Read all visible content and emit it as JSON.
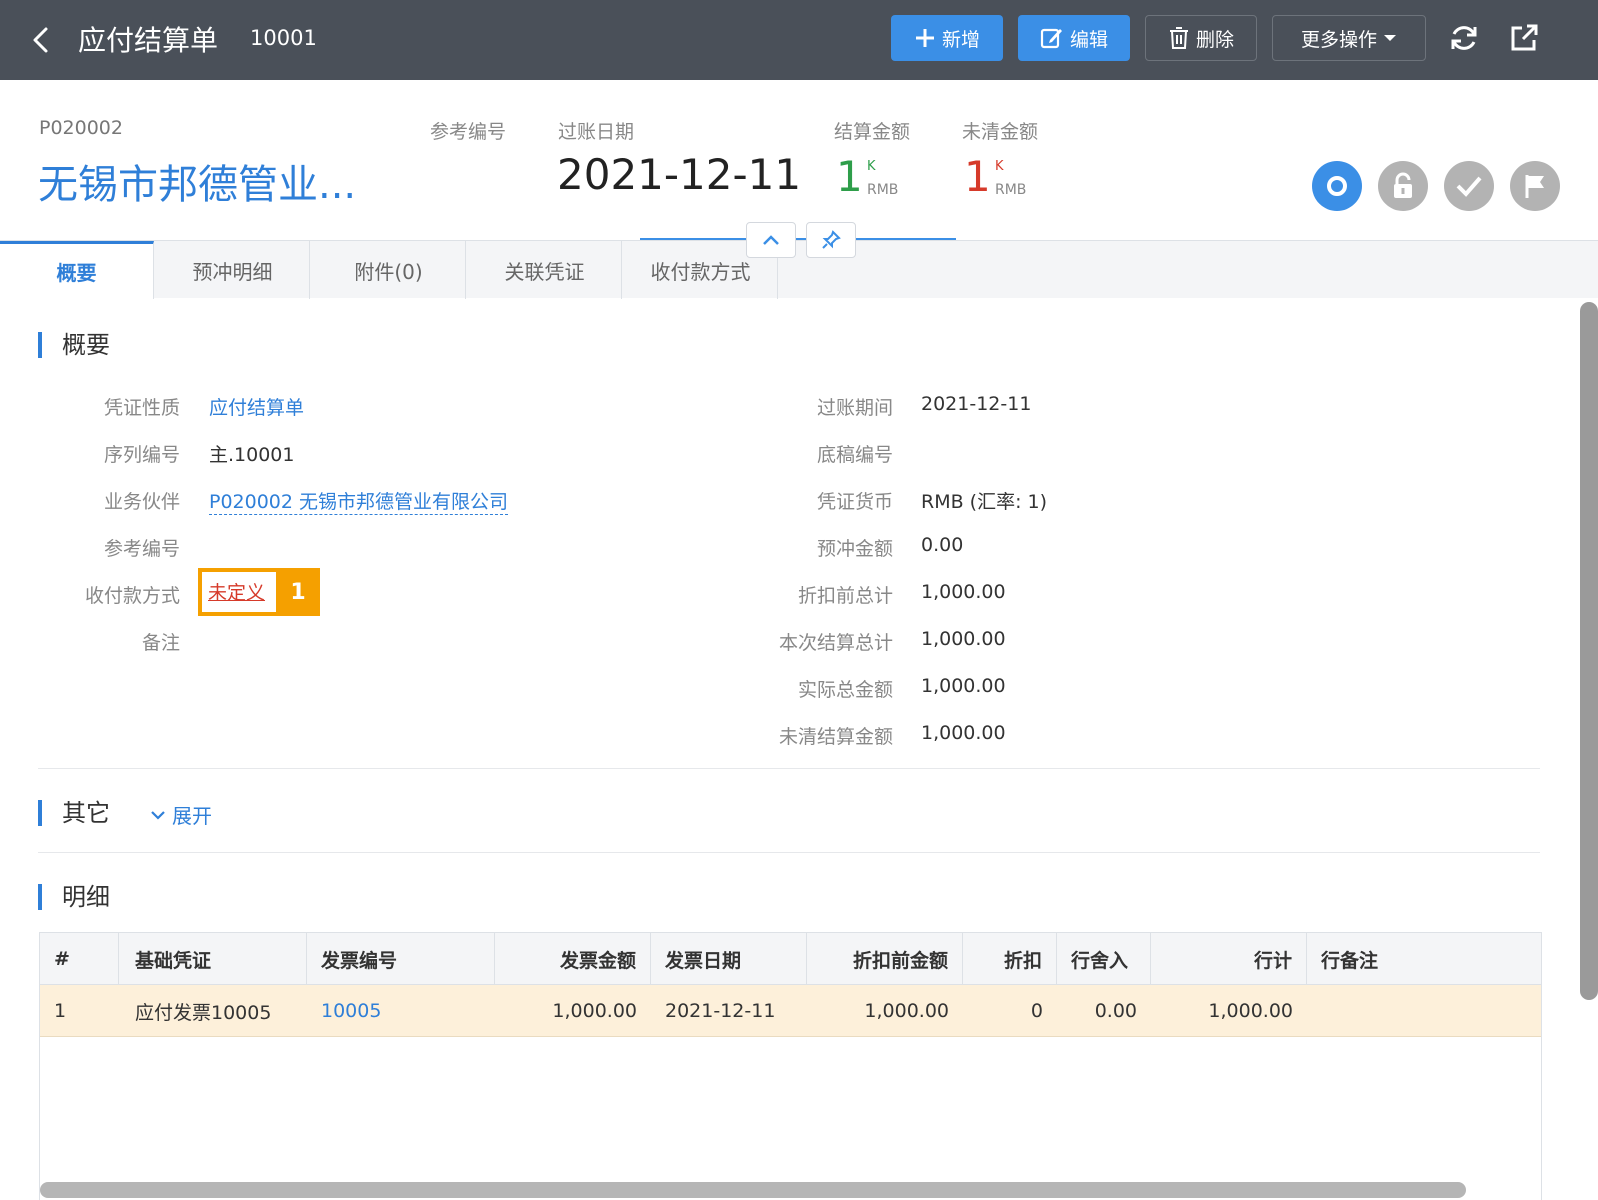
{
  "topbar": {
    "title": "应付结算单",
    "doc_no": "10001",
    "add_label": "新增",
    "edit_label": "编辑",
    "delete_label": "删除",
    "more_label": "更多操作",
    "colors": {
      "bar": "#4a5059",
      "accent": "#3b8fe6"
    }
  },
  "header": {
    "partner_code": "P020002",
    "partner_name": "无锡市邦德管业...",
    "ref_label": "参考编号",
    "post_date_label": "过账日期",
    "post_date": "2021-12-11",
    "settle_amount_label": "结算金额",
    "settle_amount": "1",
    "settle_unit": "K",
    "settle_currency": "RMB",
    "open_amount_label": "未清金额",
    "open_amount": "1",
    "open_unit": "K",
    "open_currency": "RMB",
    "status_icons": [
      "circle-status-icon",
      "unlock-icon",
      "check-icon",
      "flag-icon"
    ]
  },
  "tabs": [
    "概要",
    "预冲明细",
    "附件(0)",
    "关联凭证",
    "收付款方式"
  ],
  "summary": {
    "title": "概要",
    "left": [
      {
        "label": "凭证性质",
        "value": "应付结算单"
      },
      {
        "label": "序列编号",
        "value": "主.10001"
      },
      {
        "label": "业务伙伴",
        "value": "P020002 无锡市邦德管业有限公司"
      },
      {
        "label": "参考编号",
        "value": ""
      },
      {
        "label": "收付款方式",
        "value": "未定义"
      },
      {
        "label": "备注",
        "value": ""
      }
    ],
    "right": [
      {
        "label": "过账期间",
        "value": "2021-12-11"
      },
      {
        "label": "底稿编号",
        "value": ""
      },
      {
        "label": "凭证货币",
        "value": "RMB (汇率: 1)"
      },
      {
        "label": "预冲金额",
        "value": "0.00"
      },
      {
        "label": "折扣前总计",
        "value": "1,000.00"
      },
      {
        "label": "本次结算总计",
        "value": "1,000.00"
      },
      {
        "label": "实际总金额",
        "value": "1,000.00"
      },
      {
        "label": "未清结算金额",
        "value": "1,000.00"
      }
    ],
    "callout": "1"
  },
  "other": {
    "title": "其它",
    "expand_label": "展开"
  },
  "detail": {
    "title": "明细",
    "columns": [
      "#",
      "基础凭证",
      "发票编号",
      "发票金额",
      "发票日期",
      "折扣前金额",
      "折扣",
      "行舍入",
      "行计",
      "行备注"
    ],
    "rows": [
      [
        "1",
        "应付发票10005",
        "10005",
        "1,000.00",
        "2021-12-11",
        "1,000.00",
        "0",
        "0.00",
        "1,000.00",
        ""
      ]
    ]
  }
}
